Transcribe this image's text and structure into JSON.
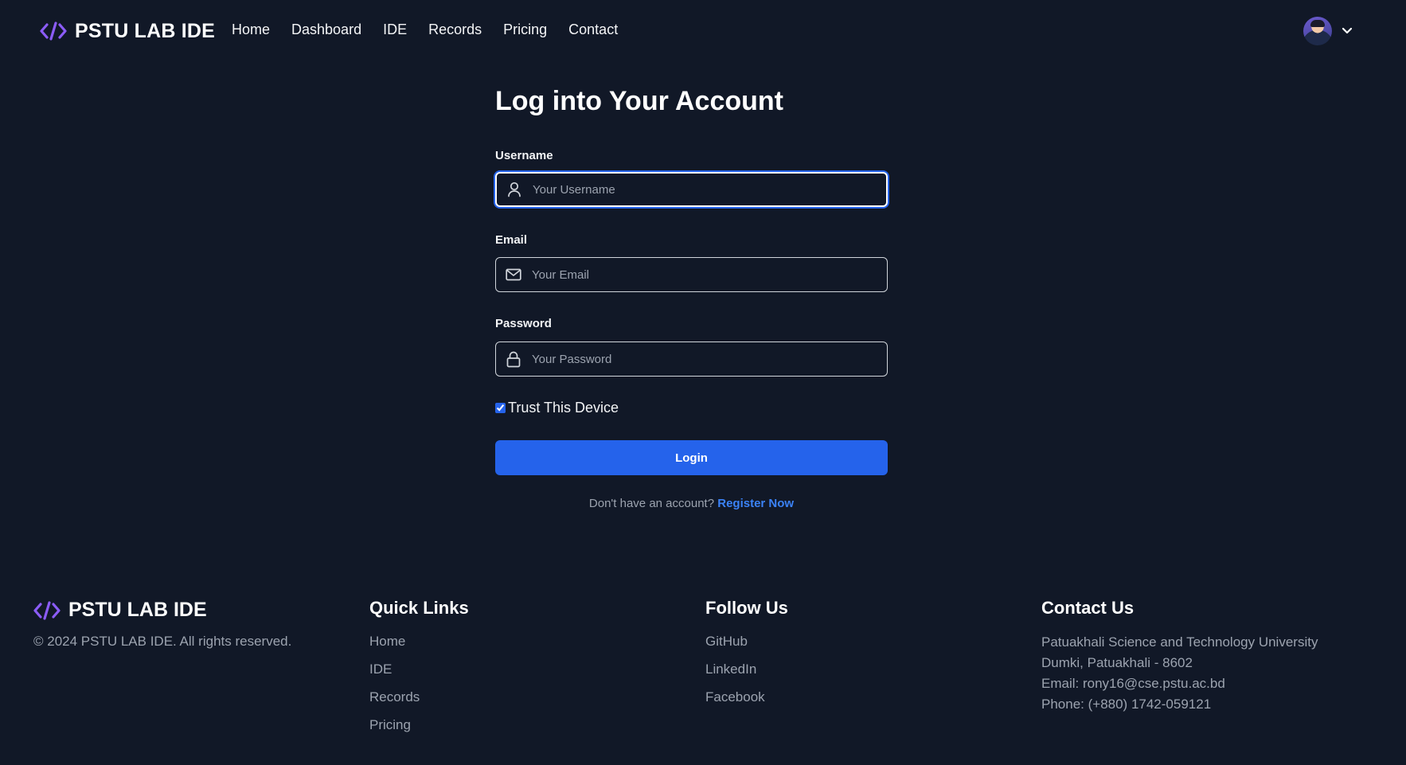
{
  "nav": {
    "brand": "PSTU LAB IDE",
    "links": [
      "Home",
      "Dashboard",
      "IDE",
      "Records",
      "Pricing",
      "Contact"
    ],
    "icons": {
      "logo": "code-icon",
      "menu": "chevron-down-icon"
    }
  },
  "login": {
    "title": "Log into Your Account",
    "username": {
      "label": "Username",
      "placeholder": "Your Username",
      "value": ""
    },
    "email": {
      "label": "Email",
      "placeholder": "Your Email",
      "value": ""
    },
    "password": {
      "label": "Password",
      "placeholder": "Your Password",
      "value": ""
    },
    "trust_label": "Trust This Device",
    "trust_checked": true,
    "button_label": "Login",
    "register_prompt": "Don't have an account?",
    "register_link": "Register Now"
  },
  "footer": {
    "brand": "PSTU LAB IDE",
    "copyright": "© 2024 PSTU LAB IDE. All rights reserved.",
    "quick_links": {
      "heading": "Quick Links",
      "items": [
        "Home",
        "IDE",
        "Records",
        "Pricing"
      ]
    },
    "follow": {
      "heading": "Follow Us",
      "items": [
        "GitHub",
        "LinkedIn",
        "Facebook"
      ]
    },
    "contact": {
      "heading": "Contact Us",
      "lines": [
        "Patuakhali Science and Technology University",
        "Dumki, Patuakhali - 8602",
        "Email: rony16@cse.pstu.ac.bd",
        "Phone: (+880) 1742-059121"
      ]
    }
  },
  "colors": {
    "background": "#111827",
    "accent": "#2563eb",
    "link": "#3b82f6",
    "logo": "#8b5cf6",
    "muted": "#9ca3af"
  }
}
